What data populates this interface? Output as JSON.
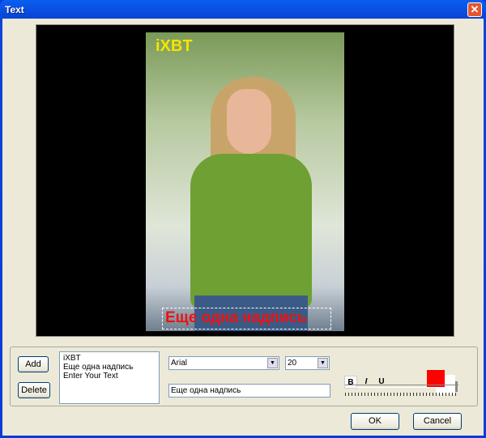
{
  "window": {
    "title": "Text"
  },
  "preview": {
    "overlay_texts": [
      "iXBT",
      "Еще одна надпись"
    ]
  },
  "buttons": {
    "add": "Add",
    "delete": "Delete",
    "ok": "OK",
    "cancel": "Cancel"
  },
  "text_list": [
    "iXBT",
    "Еще одна надпись",
    "Enter Your Text"
  ],
  "font": {
    "family": "Arial",
    "size": "20"
  },
  "style": {
    "bold": "B",
    "italic": "I",
    "underline": "U"
  },
  "text_input": {
    "value": "Еще одна надпись"
  },
  "color": {
    "foreground": "#ff0000",
    "background": "#ffffff"
  },
  "slider": {
    "value_percent": 100
  }
}
